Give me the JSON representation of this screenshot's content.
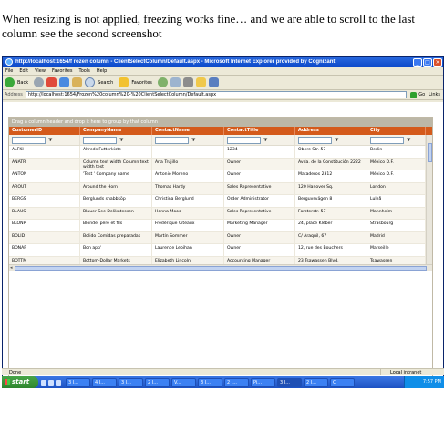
{
  "caption": "When resizing is not applied, freezing works fine… and we are able to scroll to the last column see the second screenshot",
  "window": {
    "title": "http://localhost:1654/f rozen column - ClientSelectColumn/Default.aspx - Microsoft Internet Explorer provided by Cognizant"
  },
  "menu": [
    "File",
    "Edit",
    "View",
    "Favorites",
    "Tools",
    "Help"
  ],
  "toolbar": {
    "back": "Back",
    "search": "Search",
    "favorites": "Favorites"
  },
  "address": {
    "label": "Address",
    "url": "http://localhost:1654/Frozen%20column%20-%20ClientSelectColumn/Default.aspx",
    "go": "Go",
    "links": "Links"
  },
  "grid": {
    "group_hint": "Drag a column header and drop it here to group by that column",
    "columns": [
      "CustomerID",
      "CompanyName",
      "ContactName",
      "ContactTitle",
      "Address",
      "City"
    ],
    "filter_icon": "funnel-icon",
    "rows": [
      [
        "ALFKI",
        "Alfreds Futterkiste",
        "",
        "1234-",
        "Obere Str. 57",
        "Berlin"
      ],
      [
        "ANATR",
        "Column text width Column text width test",
        "Ana Trujillo",
        "Owner",
        "Avda. de la Constitución 2222",
        "México D.F."
      ],
      [
        "ANTON",
        "'Test ' Company name",
        "Antonio Moreno",
        "Owner",
        "Mataderos 2312",
        "México D.F."
      ],
      [
        "AROUT",
        "Around the Horn",
        "Thomas Hardy",
        "Sales Representative",
        "120 Hanover Sq.",
        "London"
      ],
      [
        "BERGS",
        "Berglunds snabbköp",
        "Christina Berglund",
        "Order Administrator",
        "Berguvsvägen 8",
        "Luleå"
      ],
      [
        "BLAUS",
        "Blauer See Delikatessen",
        "Hanna Moos",
        "Sales Representative",
        "Forsterstr. 57",
        "Mannheim"
      ],
      [
        "BLONP",
        "Blondel père et fils",
        "Frédérique Citeaux",
        "Marketing Manager",
        "24, place Kléber",
        "Strasbourg"
      ],
      [
        "BOLID",
        "Bolido Comidas preparadas",
        "Martín Sommer",
        "Owner",
        "C/ Araquil, 67",
        "Madrid"
      ],
      [
        "BONAP",
        "Bon app'",
        "Laurence Lebihan",
        "Owner",
        "12, rue des Bouchers",
        "Marseille"
      ],
      [
        "BOTTM",
        "Bottom-Dollar Markets",
        "Elizabeth Lincoln",
        "Accounting Manager",
        "23 Tsawassen Blvd.",
        "Tsawassen"
      ]
    ]
  },
  "status": {
    "text": "Done",
    "zone": "Local intranet"
  },
  "taskbar": {
    "start": "start",
    "tasks": [
      "3 I...",
      "4 I...",
      "3 I...",
      "2 I...",
      "V...",
      "3 I...",
      "2 I...",
      "Pi...",
      "3 I...",
      "2 I...",
      "C"
    ],
    "clock": "7:57 PM"
  },
  "colors": {
    "grid_header": "#d45a1b",
    "titlebar": "#0a47c8",
    "taskbar": "#1c51c2"
  }
}
